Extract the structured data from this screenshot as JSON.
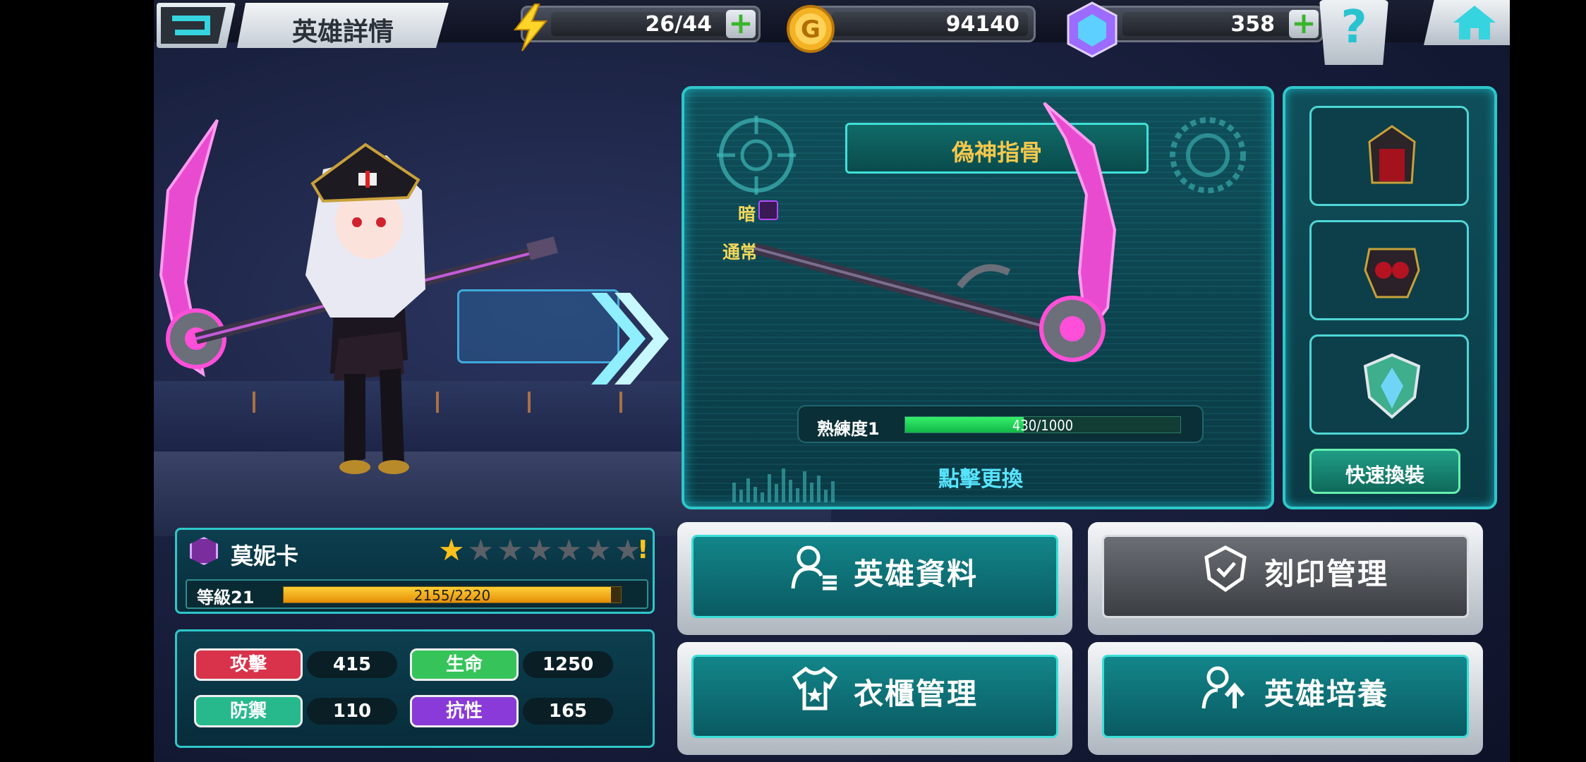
{
  "topbar": {
    "title": "英雄詳情",
    "stamina": "26/44",
    "gold": "94140",
    "gems": "358",
    "help_label": "?"
  },
  "weapon": {
    "name": "偽神指骨",
    "element": "暗",
    "type": "通常",
    "mastery_label": "熟練度1",
    "mastery_value": "430/1000",
    "mastery_fraction": 0.43,
    "tap_to_change": "點擊更換"
  },
  "equipment": {
    "slots": [
      "helmet-icon",
      "armor-icon",
      "emblem-icon"
    ],
    "quick_equip": "快速換裝"
  },
  "hero": {
    "name": "莫妮卡",
    "stars_filled": 1,
    "stars_total": 7,
    "alert": "!",
    "level_label": "等級21",
    "exp_value": "2155/2220",
    "exp_fraction": 0.971
  },
  "stats": [
    {
      "label": "攻擊",
      "value": "415",
      "color": "#d8334b"
    },
    {
      "label": "生命",
      "value": "1250",
      "color": "#36c45a"
    },
    {
      "label": "防禦",
      "value": "110",
      "color": "#27b98c"
    },
    {
      "label": "抗性",
      "value": "165",
      "color": "#8a3ad8"
    }
  ],
  "menu": {
    "hero_info": "英雄資料",
    "seal_manage": "刻印管理",
    "wardrobe": "衣櫃管理",
    "hero_training": "英雄培養"
  },
  "colors": {
    "accent": "#2ec7c9",
    "gold_text": "#f7c84b",
    "mastery_bar": "#34ef6a",
    "exp_bar": "#ffcf36"
  }
}
